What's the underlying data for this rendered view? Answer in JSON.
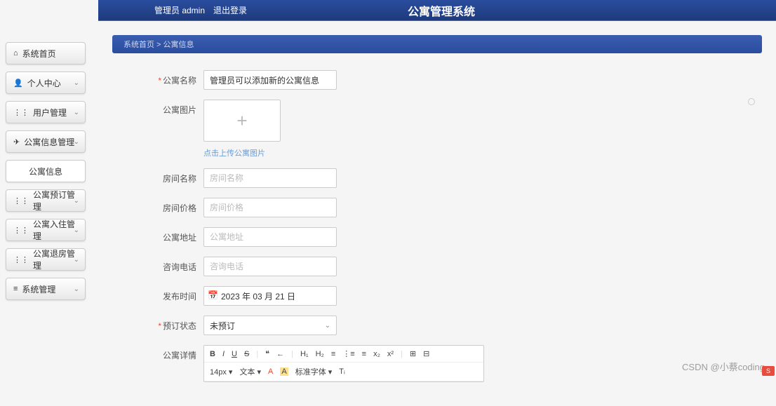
{
  "header": {
    "admin_label": "管理员 admin",
    "logout": "退出登录",
    "title": "公寓管理系统"
  },
  "sidebar": {
    "items": [
      {
        "icon": "⌂",
        "label": "系统首页",
        "expandable": false
      },
      {
        "icon": "👤",
        "label": "个人中心",
        "expandable": true
      },
      {
        "icon": "⋮⋮",
        "label": "用户管理",
        "expandable": true
      },
      {
        "icon": "✈",
        "label": "公寓信息管理",
        "expandable": true
      },
      {
        "icon": "",
        "label": "公寓信息",
        "expandable": false,
        "sub": true
      },
      {
        "icon": "⋮⋮",
        "label": "公寓预订管理",
        "expandable": true
      },
      {
        "icon": "⋮⋮",
        "label": "公寓入住管理",
        "expandable": true
      },
      {
        "icon": "⋮⋮",
        "label": "公寓退房管理",
        "expandable": true
      },
      {
        "icon": "≡",
        "label": "系统管理",
        "expandable": true
      }
    ]
  },
  "breadcrumb": "系统首页  >  公寓信息",
  "form": {
    "apt_name": {
      "label": "公寓名称",
      "value": "管理员可以添加新的公寓信息",
      "required": true
    },
    "apt_image": {
      "label": "公寓图片",
      "hint": "点击上传公寓图片"
    },
    "room_name": {
      "label": "房间名称",
      "placeholder": "房间名称"
    },
    "room_price": {
      "label": "房间价格",
      "placeholder": "房间价格"
    },
    "apt_addr": {
      "label": "公寓地址",
      "placeholder": "公寓地址"
    },
    "phone": {
      "label": "咨询电话",
      "placeholder": "咨询电话"
    },
    "pub_date": {
      "label": "发布时间",
      "value": "2023 年 03 月 21 日"
    },
    "book_status": {
      "label": "预订状态",
      "value": "未预订",
      "required": true
    },
    "detail": {
      "label": "公寓详情"
    }
  },
  "editor": {
    "row1": [
      "B",
      "I",
      "U",
      "S",
      "ꜟꜟ",
      "❝",
      "←",
      "H₁",
      "H₂",
      "≡",
      "⋮≡",
      "≡",
      "x₂",
      "x²",
      "⊞",
      "⊟"
    ],
    "row2_fontsize": "14px",
    "row2_texttype": "文本",
    "row2_fontfamily": "标准字体",
    "row2_icons": [
      "A",
      "A",
      "Tᵢ"
    ]
  },
  "watermark": "CSDN @小蔡coding"
}
